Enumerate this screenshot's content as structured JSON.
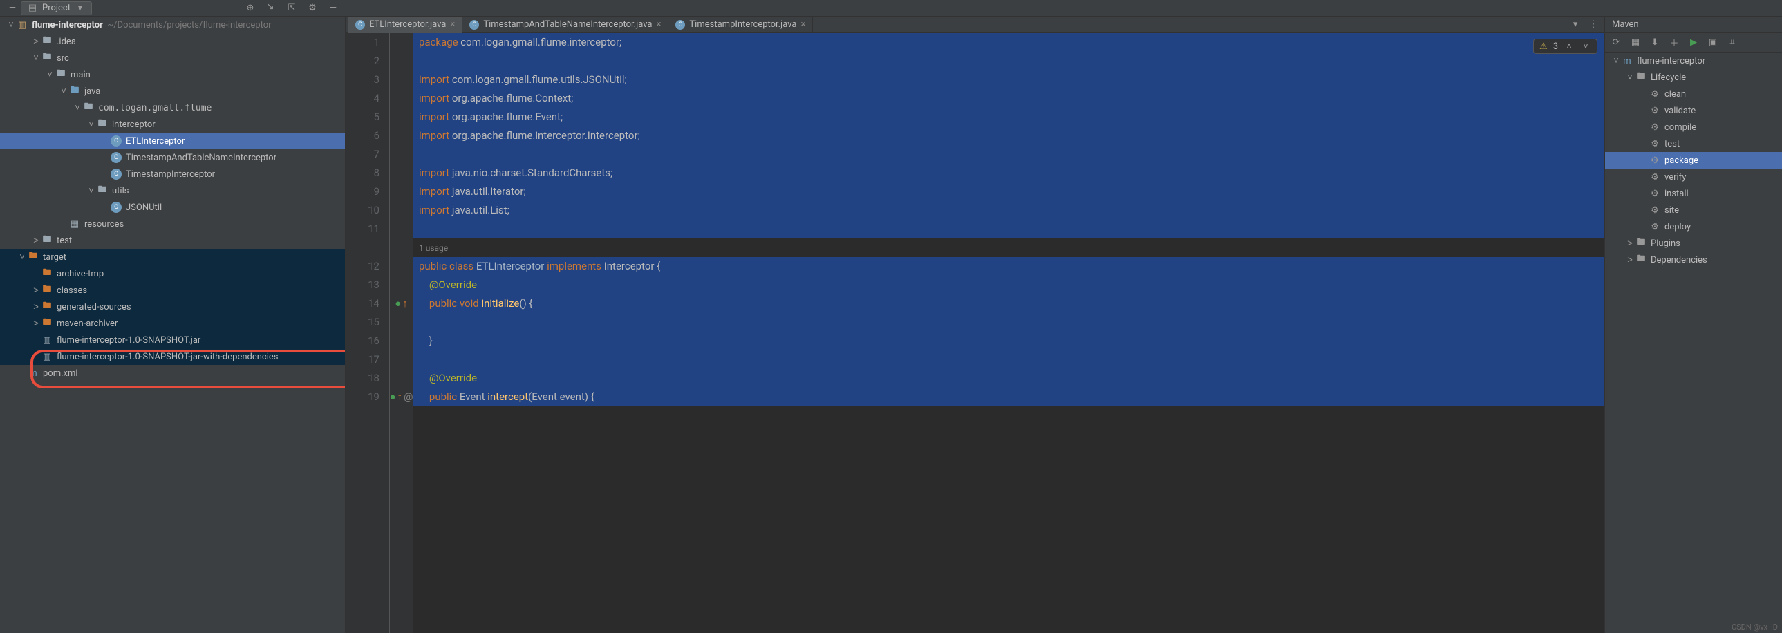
{
  "project_tool": {
    "label": "Project"
  },
  "editor_tabs": [
    {
      "name": "ETLInterceptor.java",
      "active": true
    },
    {
      "name": "TimestampAndTableNameInterceptor.java",
      "active": false
    },
    {
      "name": "TimestampInterceptor.java",
      "active": false
    }
  ],
  "inspection": {
    "warnings": 3
  },
  "project_tree": {
    "root": {
      "name": "flume-interceptor",
      "path": "~/Documents/projects/flume-interceptor"
    },
    "nodes": [
      {
        "indent": 1,
        "arrow": ">",
        "icon": "folder-gray",
        "label": ".idea"
      },
      {
        "indent": 1,
        "arrow": "v",
        "icon": "folder-gray",
        "label": "src"
      },
      {
        "indent": 2,
        "arrow": "v",
        "icon": "folder-gray",
        "label": "main"
      },
      {
        "indent": 3,
        "arrow": "v",
        "icon": "folder-blue",
        "label": "java"
      },
      {
        "indent": 4,
        "arrow": "v",
        "icon": "folder-gray",
        "label": "com.logan.gmall.flume",
        "pkg": true
      },
      {
        "indent": 5,
        "arrow": "v",
        "icon": "folder-gray",
        "label": "interceptor"
      },
      {
        "indent": 6,
        "arrow": "",
        "icon": "class",
        "label": "ETLInterceptor",
        "selected": true
      },
      {
        "indent": 6,
        "arrow": "",
        "icon": "class",
        "label": "TimestampAndTableNameInterceptor"
      },
      {
        "indent": 6,
        "arrow": "",
        "icon": "class",
        "label": "TimestampInterceptor"
      },
      {
        "indent": 5,
        "arrow": "v",
        "icon": "folder-gray",
        "label": "utils"
      },
      {
        "indent": 6,
        "arrow": "",
        "icon": "class",
        "label": "JSONUtil"
      },
      {
        "indent": 3,
        "arrow": "",
        "icon": "folder-res",
        "label": "resources"
      },
      {
        "indent": 1,
        "arrow": ">",
        "icon": "folder-gray",
        "label": "test"
      },
      {
        "indent": 0,
        "arrow": "v",
        "icon": "folder-y",
        "label": "target",
        "highlighted": true
      },
      {
        "indent": 1,
        "arrow": "",
        "icon": "folder-y",
        "label": "archive-tmp",
        "highlighted": true
      },
      {
        "indent": 1,
        "arrow": ">",
        "icon": "folder-y",
        "label": "classes",
        "highlighted": true
      },
      {
        "indent": 1,
        "arrow": ">",
        "icon": "folder-y",
        "label": "generated-sources",
        "highlighted": true
      },
      {
        "indent": 1,
        "arrow": ">",
        "icon": "folder-y",
        "label": "maven-archiver",
        "highlighted": true
      },
      {
        "indent": 1,
        "arrow": "",
        "icon": "jar",
        "label": "flume-interceptor-1.0-SNAPSHOT.jar",
        "highlighted": true
      },
      {
        "indent": 1,
        "arrow": "",
        "icon": "jar",
        "label": "flume-interceptor-1.0-SNAPSHOT-jar-with-dependencies",
        "highlighted": true,
        "circled": true
      },
      {
        "indent": 0,
        "arrow": "",
        "icon": "xml",
        "label": "pom.xml"
      }
    ]
  },
  "code": {
    "lines": [
      {
        "n": 1,
        "sel": true,
        "html": "<span class='kw'>package</span> com.logan.gmall.flume.interceptor;"
      },
      {
        "n": 2,
        "sel": true,
        "html": ""
      },
      {
        "n": 3,
        "sel": true,
        "html": "<span class='kw'>import</span> com.logan.gmall.flume.utils.JSONUtil;"
      },
      {
        "n": 4,
        "sel": true,
        "html": "<span class='kw'>import</span> org.apache.flume.Context;"
      },
      {
        "n": 5,
        "sel": true,
        "html": "<span class='kw'>import</span> org.apache.flume.Event;"
      },
      {
        "n": 6,
        "sel": true,
        "html": "<span class='kw'>import</span> org.apache.flume.interceptor.Interceptor;"
      },
      {
        "n": 7,
        "sel": true,
        "html": ""
      },
      {
        "n": 8,
        "sel": true,
        "html": "<span class='kw'>import</span> java.nio.charset.StandardCharsets;"
      },
      {
        "n": 9,
        "sel": true,
        "html": "<span class='kw'>import</span> java.util.Iterator;"
      },
      {
        "n": 10,
        "sel": true,
        "html": "<span class='kw'>import</span> java.util.List;"
      },
      {
        "n": 11,
        "sel": true,
        "html": ""
      },
      {
        "n": null,
        "sel": false,
        "usage": true,
        "html": "<span class='usage'>1 usage</span>"
      },
      {
        "n": 12,
        "sel": true,
        "html": "<span class='kw'>public class</span> <span class='cls'>ETLInterceptor</span> <span class='kw'>implements</span> Interceptor {"
      },
      {
        "n": 13,
        "sel": true,
        "html": "    <span class='ann'>@Override</span>"
      },
      {
        "n": 14,
        "sel": true,
        "vcs": true,
        "html": "    <span class='kw'>public void</span> <span class='fn'>initialize</span>() {"
      },
      {
        "n": 15,
        "sel": true,
        "html": ""
      },
      {
        "n": 16,
        "sel": true,
        "html": "    }"
      },
      {
        "n": 17,
        "sel": true,
        "html": ""
      },
      {
        "n": 18,
        "sel": true,
        "html": "    <span class='ann'>@Override</span>"
      },
      {
        "n": 19,
        "sel": true,
        "vcs": true,
        "at": true,
        "html": "    <span class='kw'>public</span> Event <span class='fn'>intercept</span>(Event event) {"
      }
    ]
  },
  "maven": {
    "title": "Maven",
    "root": "flume-interceptor",
    "lifecycle_label": "Lifecycle",
    "lifecycle": [
      "clean",
      "validate",
      "compile",
      "test",
      "package",
      "verify",
      "install",
      "site",
      "deploy"
    ],
    "selected": "package",
    "extras": [
      "Plugins",
      "Dependencies"
    ]
  },
  "watermark": "CSDN @vx_iD"
}
